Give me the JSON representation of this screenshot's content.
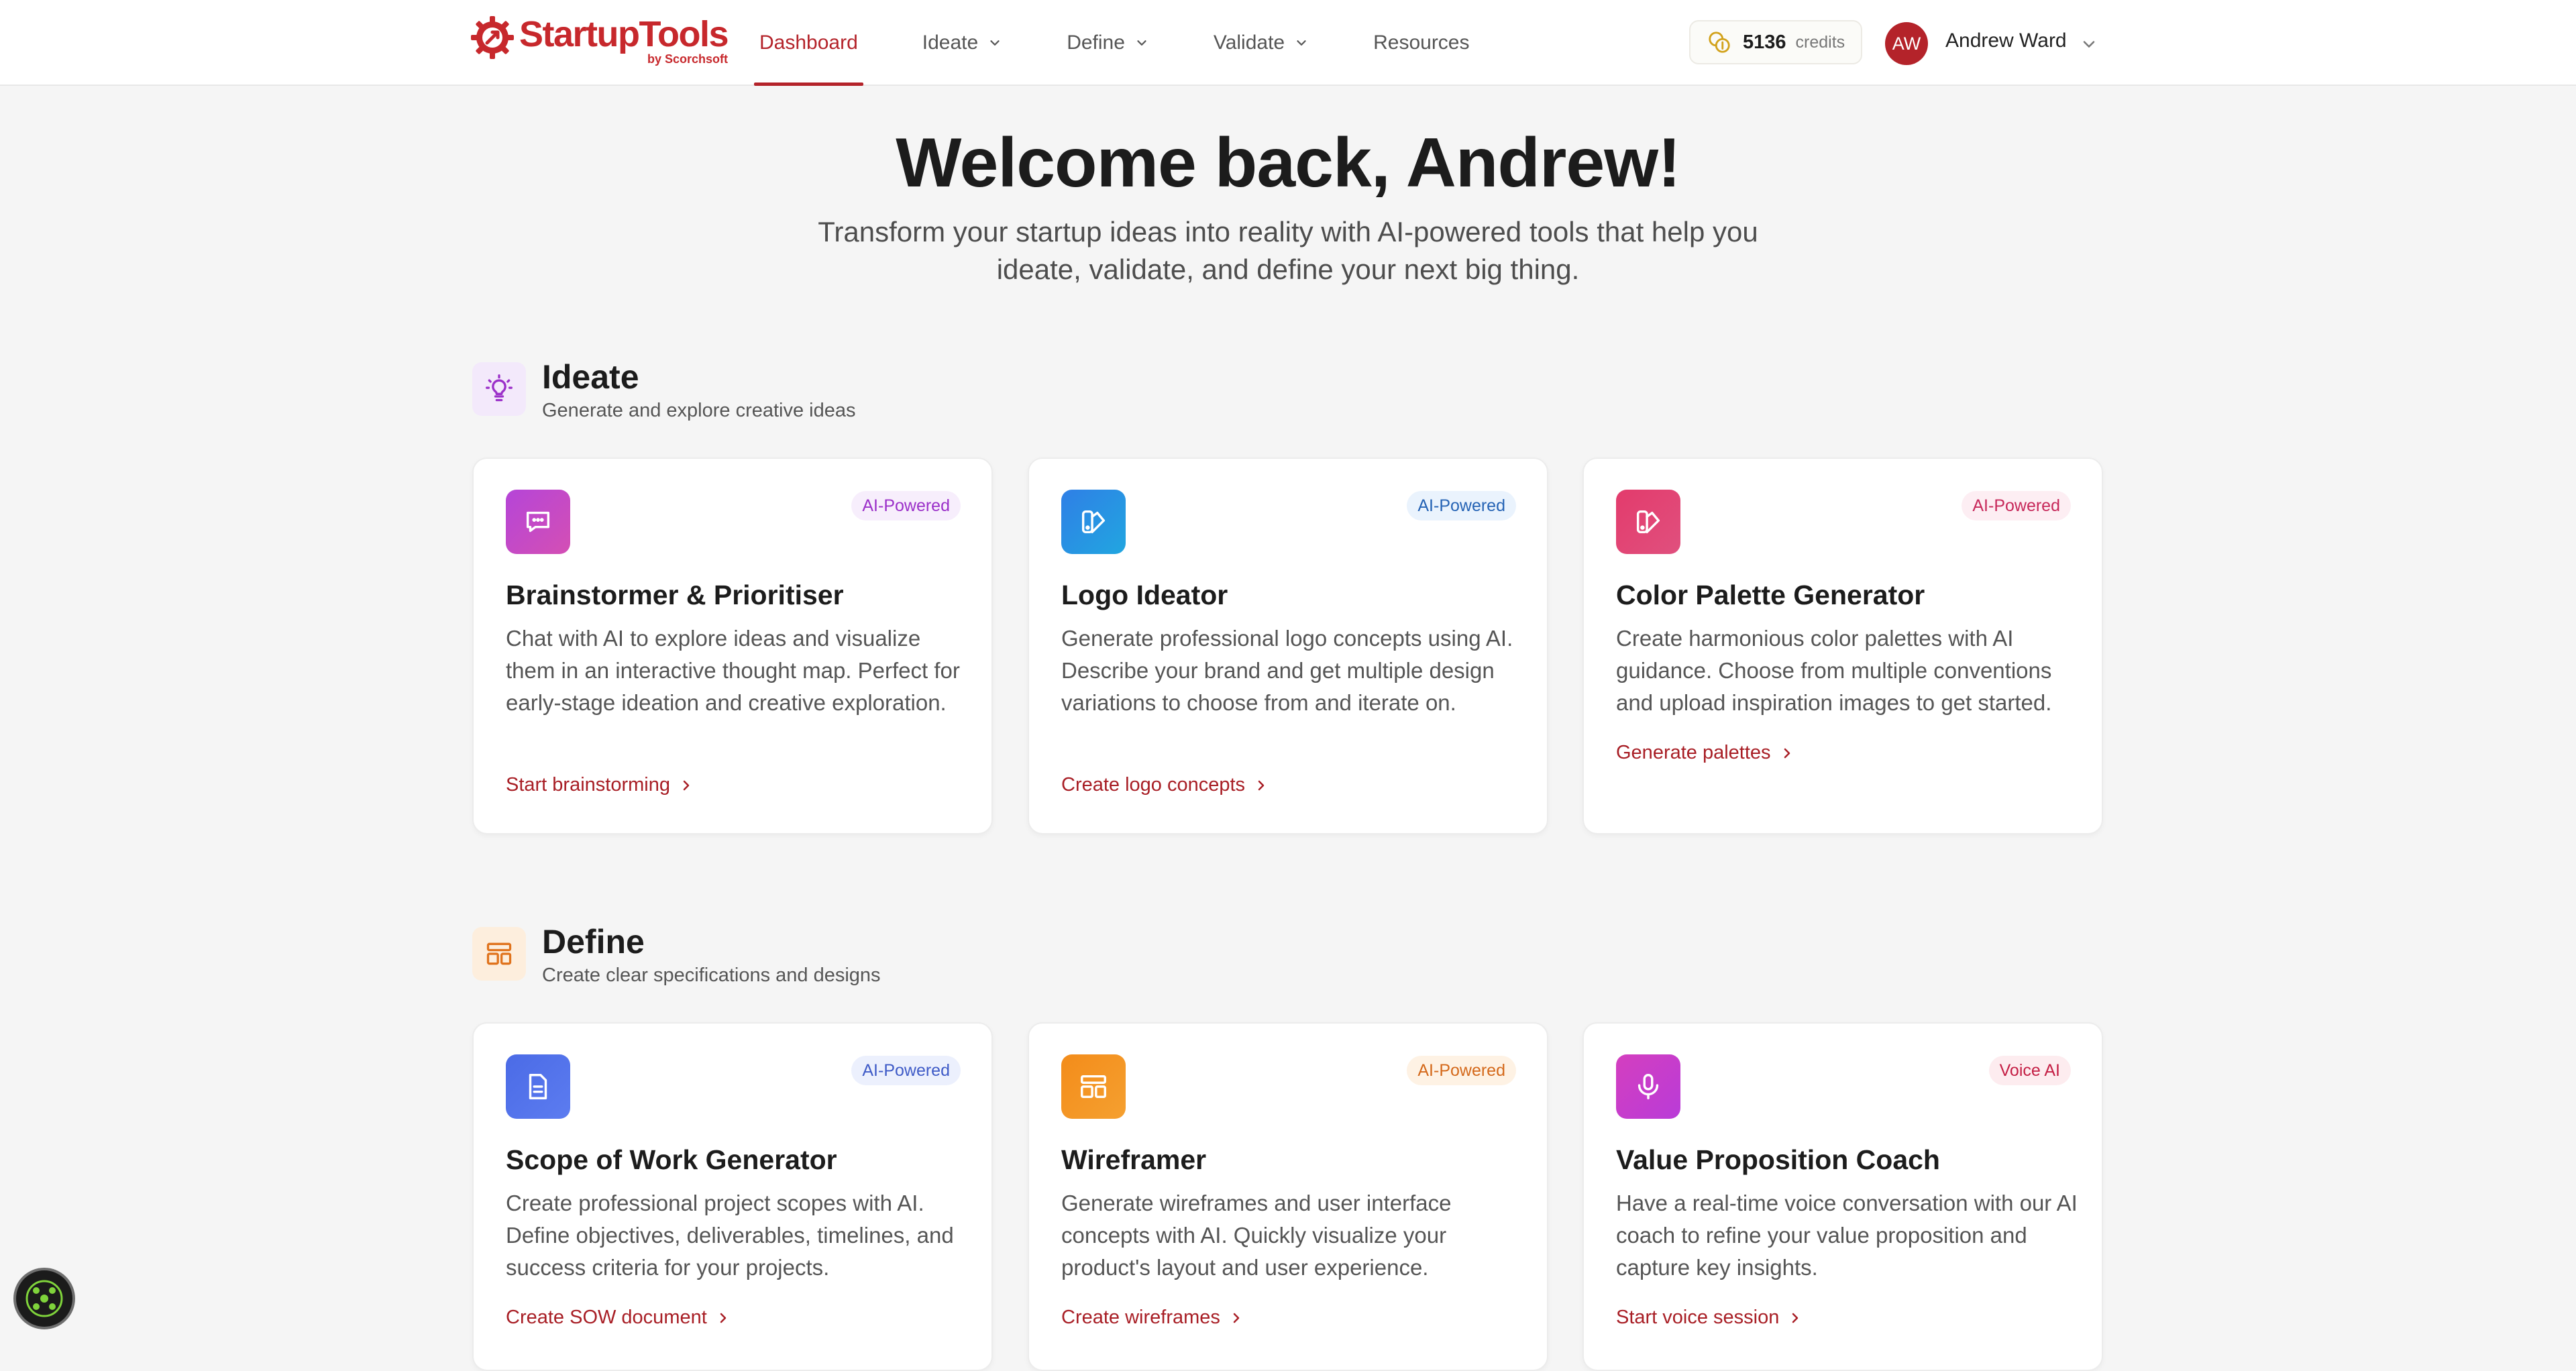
{
  "brand": {
    "name": "StartupTools",
    "sub": "by Scorchsoft",
    "color": "#c7282c"
  },
  "nav": {
    "items": [
      {
        "label": "Dashboard",
        "active": true,
        "dropdown": false
      },
      {
        "label": "Ideate",
        "active": false,
        "dropdown": true
      },
      {
        "label": "Define",
        "active": false,
        "dropdown": true
      },
      {
        "label": "Validate",
        "active": false,
        "dropdown": true
      },
      {
        "label": "Resources",
        "active": false,
        "dropdown": false
      }
    ]
  },
  "credits": {
    "value": "5136",
    "label": "credits",
    "icon": "coins-icon"
  },
  "user": {
    "initials": "AW",
    "name": "Andrew Ward"
  },
  "hero": {
    "title": "Welcome back, Andrew!",
    "subtitle": "Transform your startup ideas into reality with AI-powered tools that help you ideate, validate, and define your next big thing."
  },
  "sections": [
    {
      "title": "Ideate",
      "description": "Generate and explore creative ideas",
      "icon": "lightbulb-icon",
      "cards": [
        {
          "title": "Brainstormer & Prioritiser",
          "description": "Chat with AI to explore ideas and visualize them in an interactive thought map. Perfect for early-stage ideation and creative exploration.",
          "badge": "AI-Powered",
          "link": "Start brainstorming",
          "icon": "chat-icon"
        },
        {
          "title": "Logo Ideator",
          "description": "Generate professional logo concepts using AI. Describe your brand and get multiple design variations to choose from and iterate on.",
          "badge": "AI-Powered",
          "link": "Create logo concepts",
          "icon": "swatch-icon"
        },
        {
          "title": "Color Palette Generator",
          "description": "Create harmonious color palettes with AI guidance. Choose from multiple conventions and upload inspiration images to get started.",
          "badge": "AI-Powered",
          "link": "Generate palettes",
          "icon": "palette-icon"
        }
      ]
    },
    {
      "title": "Define",
      "description": "Create clear specifications and designs",
      "icon": "layout-icon",
      "cards": [
        {
          "title": "Scope of Work Generator",
          "description": "Create professional project scopes with AI. Define objectives, deliverables, timelines, and success criteria for your projects.",
          "badge": "AI-Powered",
          "link": "Create SOW document",
          "icon": "document-icon"
        },
        {
          "title": "Wireframer",
          "description": "Generate wireframes and user interface concepts with AI. Quickly visualize your product's layout and user experience.",
          "badge": "AI-Powered",
          "link": "Create wireframes",
          "icon": "wireframe-icon"
        },
        {
          "title": "Value Proposition Coach",
          "description": "Have a real-time voice conversation with our AI coach to refine your value proposition and capture key insights.",
          "badge": "Voice AI",
          "link": "Start voice session",
          "icon": "microphone-icon"
        }
      ]
    }
  ],
  "widget": {
    "icon": "assistant-icon"
  }
}
